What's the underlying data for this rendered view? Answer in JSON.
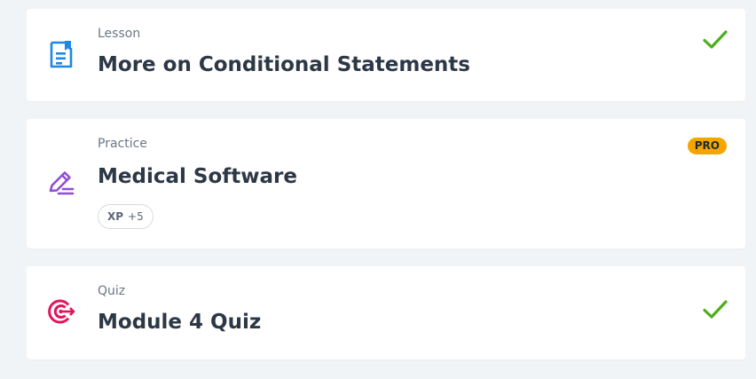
{
  "items": [
    {
      "type_label": "Lesson",
      "title": "More on Conditional Statements",
      "icon": "lesson-document-icon",
      "icon_color": "#1e88e5",
      "status": "completed",
      "status_icon": "checkmark-icon",
      "status_color": "#4caf1a"
    },
    {
      "type_label": "Practice",
      "title": "Medical Software",
      "icon": "practice-pencil-icon",
      "icon_color": "#8e4fd6",
      "badge": "PRO",
      "badge_color": "#f5a500",
      "xp_label": "XP",
      "xp_value": "+5"
    },
    {
      "type_label": "Quiz",
      "title": "Module 4 Quiz",
      "icon": "quiz-target-icon",
      "icon_color": "#e0155d",
      "status": "completed",
      "status_icon": "checkmark-icon",
      "status_color": "#4caf1a"
    }
  ],
  "colors": {
    "background": "#f1f4f7",
    "card": "#ffffff",
    "title_text": "#2d3846",
    "label_text": "#6b7785"
  }
}
